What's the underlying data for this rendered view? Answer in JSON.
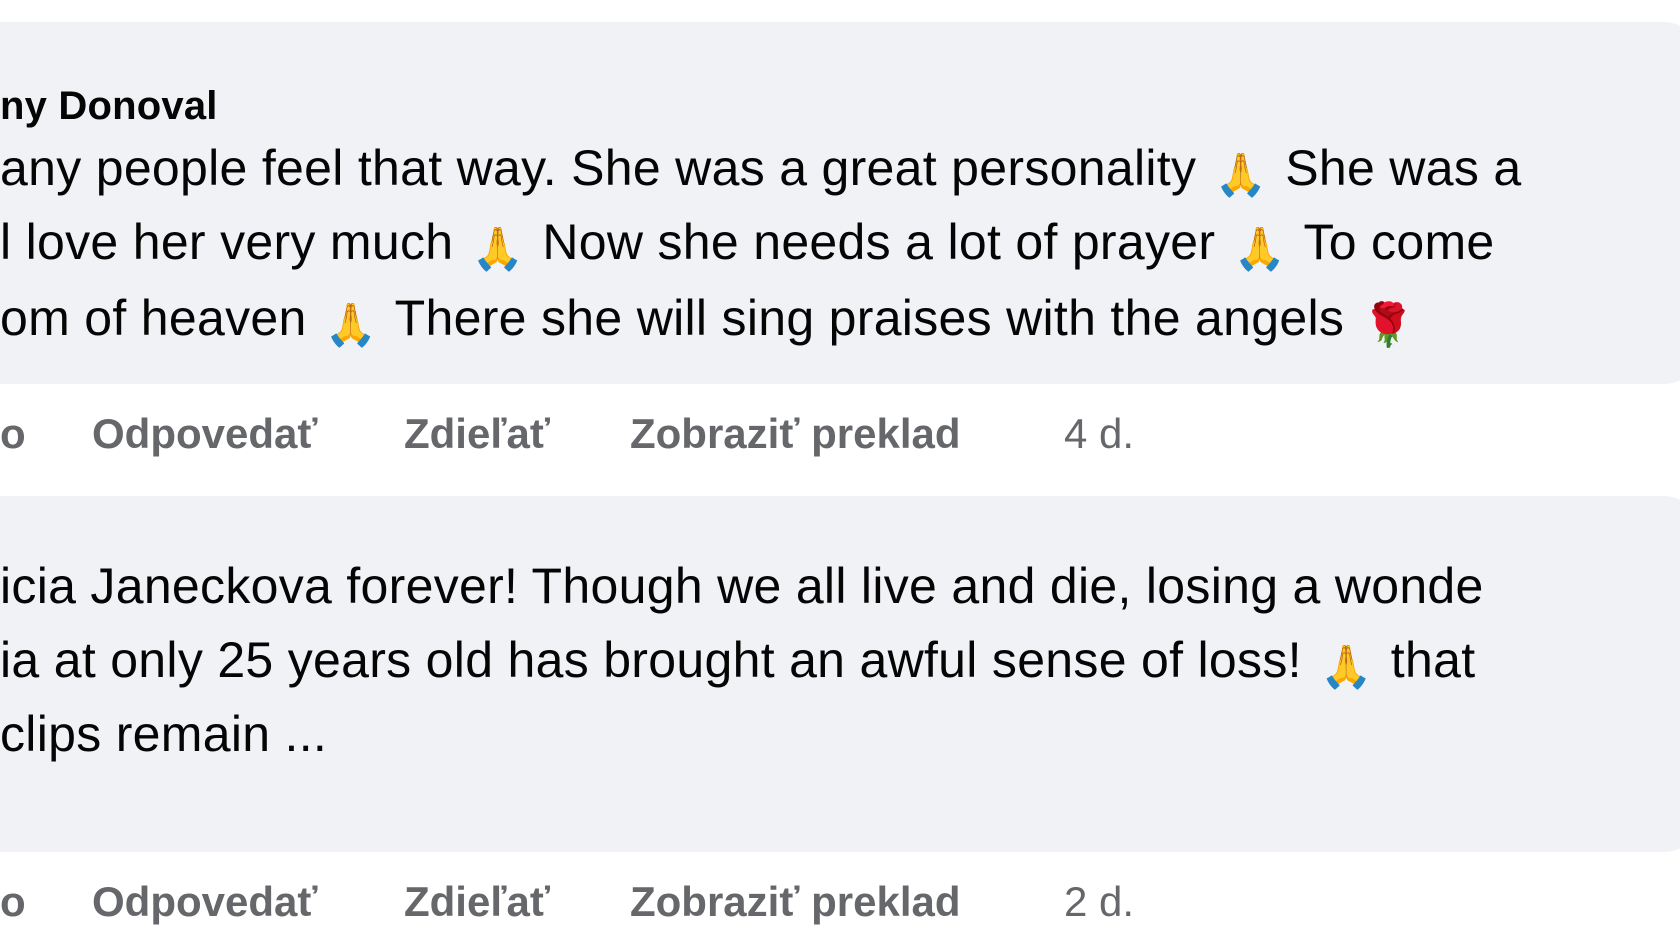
{
  "comments": [
    {
      "author": "ny Donoval",
      "lines": [
        [
          "any people feel that way. She was a great personality ",
          "🙏",
          " She was a"
        ],
        [
          "l love her very much ",
          "🙏",
          " Now she needs a lot of prayer ",
          "🙏",
          " To come"
        ],
        [
          "om of heaven ",
          "🙏",
          " There she will sing praises with the angels ",
          "🌹"
        ]
      ],
      "actions": {
        "like": "o",
        "reply": "Odpovedať",
        "share": "Zdieľať",
        "translate": "Zobraziť preklad",
        "time": "4 d."
      }
    },
    {
      "author": "",
      "lines": [
        [
          "icia Janeckova forever! Though we all live and die, losing a wonde"
        ],
        [
          "ia at only 25 years old has brought an awful sense of loss! ",
          "🙏",
          " that"
        ],
        [
          "clips remain ..."
        ]
      ],
      "actions": {
        "like": "o",
        "reply": "Odpovedať",
        "share": "Zdieľať",
        "translate": "Zobraziť preklad",
        "time": "2 d."
      }
    }
  ]
}
